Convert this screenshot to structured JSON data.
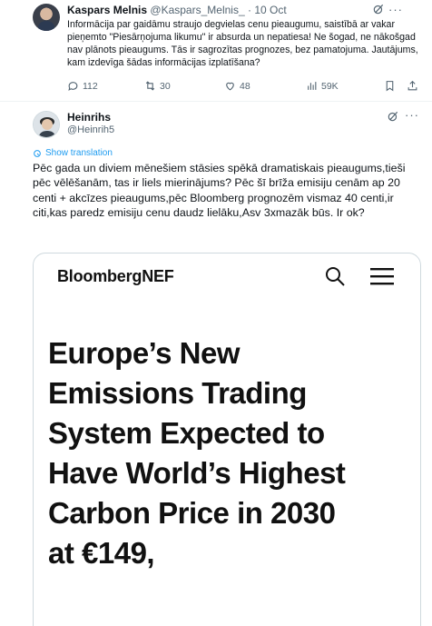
{
  "tweet1": {
    "author_name": "Kaspars Melnis",
    "author_handle": "@Kaspars_Melnis_",
    "separator": "·",
    "timestamp": "10 Oct",
    "more": "···",
    "text": "Informācija par gaidāmu straujo degvielas cenu pieaugumu, saistībā ar vakar pieņemto \"Piesārņojuma likumu\" ir absurda un nepatiesa! Ne šogad, ne nākošgad nav plānots pieaugums. Tās ir sagrozītas prognozes, bez pamatojuma. Jautājums, kam izdevīga šādas informācijas izplatīšana?",
    "actions": {
      "replies": "112",
      "reposts": "30",
      "likes": "48",
      "views": "59K"
    }
  },
  "tweet2": {
    "author_name": "Heinrihs",
    "author_handle": "@Heinrih5",
    "more": "···",
    "show_translation": "Show translation",
    "text": "Pēc gada un diviem mēnešiem stāsies spēkā dramatiskais pieaugums,tieši pēc vēlēšanām, tas ir liels mierinājums? Pēc šī brīža emisiju cenām ap 20 centi + akcīzes pieaugums,pēc Bloomberg prognozēm vismaz 40 centi,ir citi,kas paredz emisiju cenu daudz lielāku,Asv 3xmazāk būs. Ir ok?",
    "card": {
      "logo": "BloombergNEF",
      "headline": "Europe’s New\nEmissions Trading\nSystem Expected to\nHave World’s Highest\nCarbon Price in 2030\nat €149,"
    }
  },
  "colors": {
    "text": "#0f1419",
    "secondary": "#536471",
    "link": "#1d9bf0",
    "border": "#cfd9de"
  }
}
